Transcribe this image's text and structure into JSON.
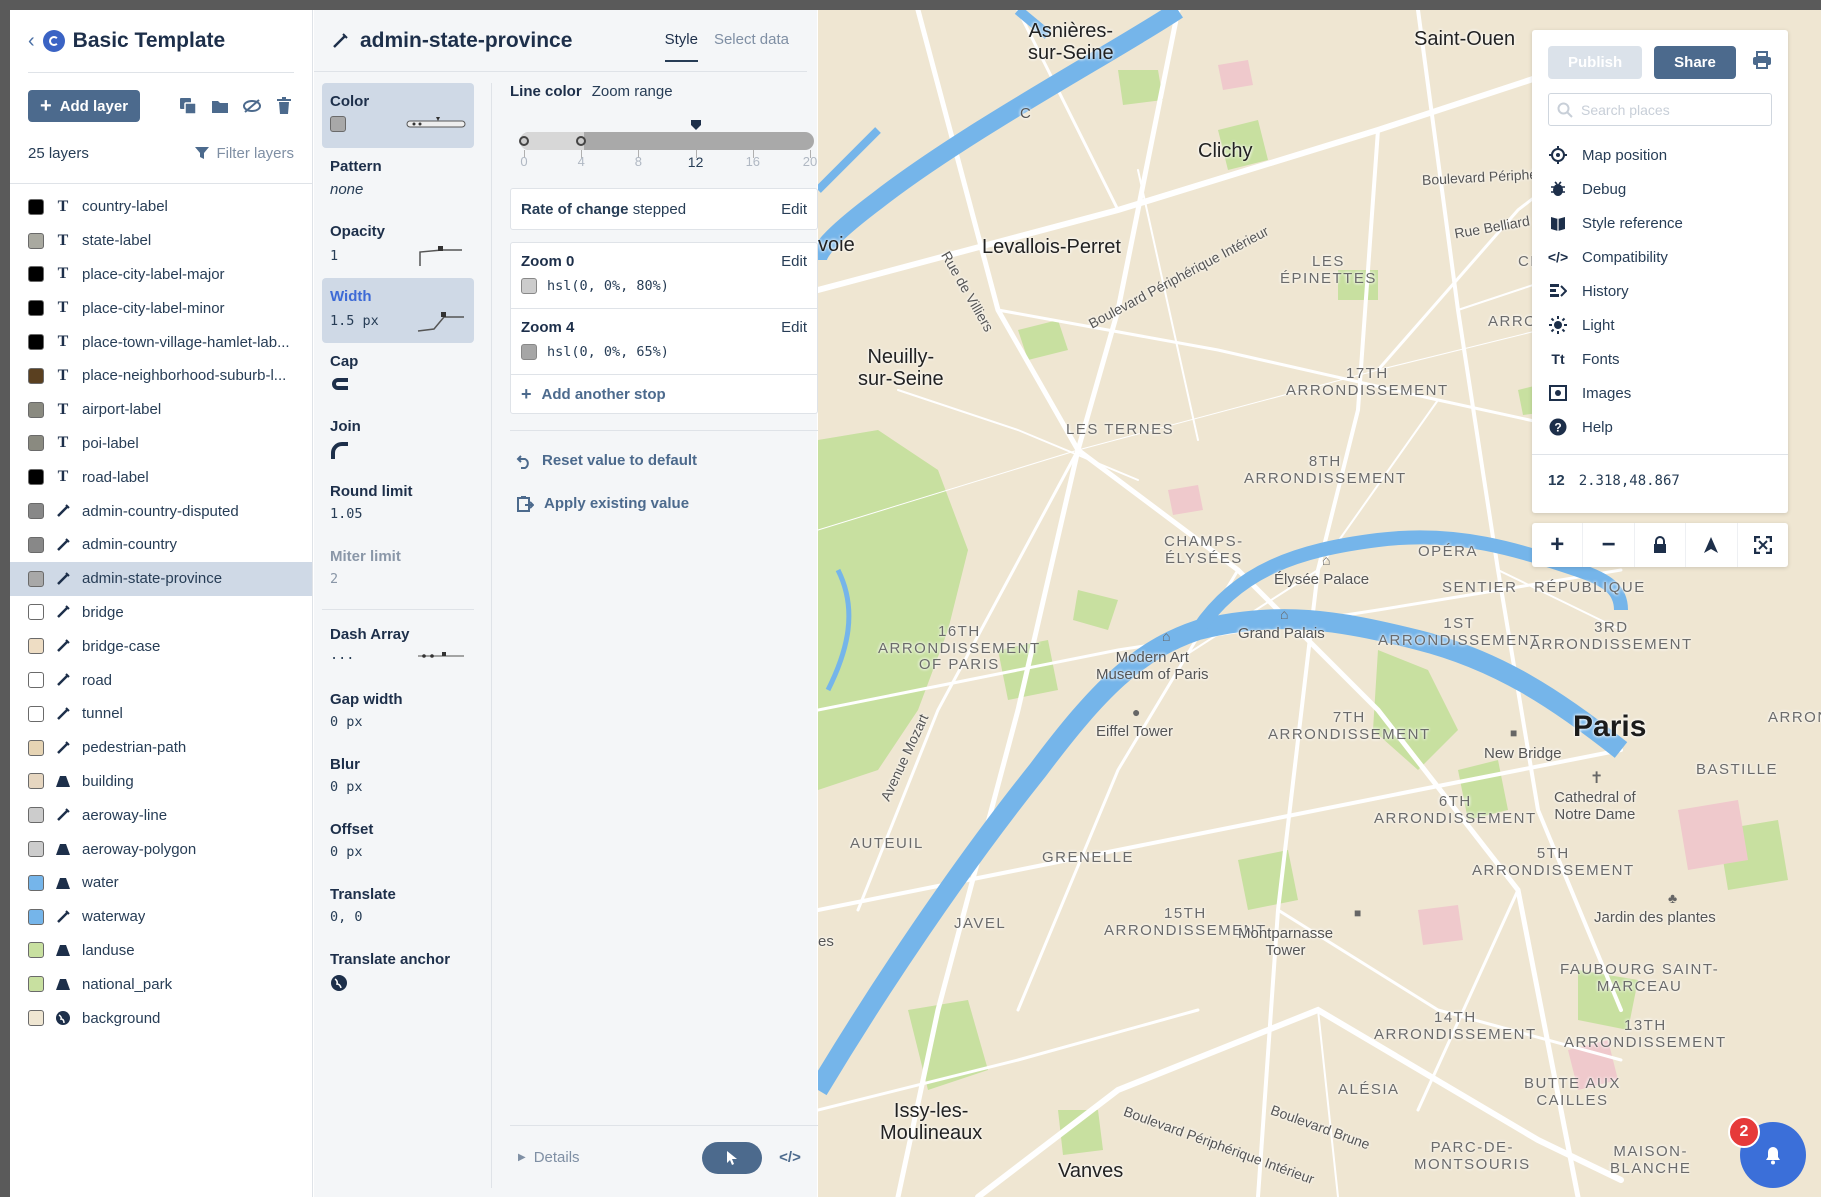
{
  "app": {
    "title": "Basic Template"
  },
  "toolbar": {
    "add_layer_label": "Add layer",
    "layer_count": "25 layers",
    "filter_label": "Filter layers"
  },
  "layers": [
    {
      "name": "country-label",
      "type": "T",
      "color": "#000000"
    },
    {
      "name": "state-label",
      "type": "T",
      "color": "#a9a9a0"
    },
    {
      "name": "place-city-label-major",
      "type": "T",
      "color": "#000000"
    },
    {
      "name": "place-city-label-minor",
      "type": "T",
      "color": "#000000"
    },
    {
      "name": "place-town-village-hamlet-lab...",
      "type": "T",
      "color": "#000000"
    },
    {
      "name": "place-neighborhood-suburb-l...",
      "type": "T",
      "color": "#5a4020"
    },
    {
      "name": "airport-label",
      "type": "T",
      "color": "#8a8a80"
    },
    {
      "name": "poi-label",
      "type": "T",
      "color": "#8a8a80"
    },
    {
      "name": "road-label",
      "type": "T",
      "color": "#000000"
    },
    {
      "name": "admin-country-disputed",
      "type": "line",
      "color": "#888888"
    },
    {
      "name": "admin-country",
      "type": "line",
      "color": "#888888"
    },
    {
      "name": "admin-state-province",
      "type": "line",
      "color": "#a8a8a8"
    },
    {
      "name": "bridge",
      "type": "line",
      "color": "#ffffff"
    },
    {
      "name": "bridge-case",
      "type": "line",
      "color": "#eeddc4"
    },
    {
      "name": "road",
      "type": "line",
      "color": "#ffffff"
    },
    {
      "name": "tunnel",
      "type": "line",
      "color": "#ffffff"
    },
    {
      "name": "pedestrian-path",
      "type": "line",
      "color": "#e6d4b4"
    },
    {
      "name": "building",
      "type": "fill",
      "color": "#e6d6c0"
    },
    {
      "name": "aeroway-line",
      "type": "line",
      "color": "#cccccc"
    },
    {
      "name": "aeroway-polygon",
      "type": "fill",
      "color": "#cccccc"
    },
    {
      "name": "water",
      "type": "fill",
      "color": "#75b5ea"
    },
    {
      "name": "waterway",
      "type": "line",
      "color": "#75b5ea"
    },
    {
      "name": "landuse",
      "type": "fill",
      "color": "#c8e0a0"
    },
    {
      "name": "national_park",
      "type": "fill",
      "color": "#c8e0a0"
    },
    {
      "name": "background",
      "type": "bg",
      "color": "#efe6d2"
    }
  ],
  "selected_layer": "admin-state-province",
  "props": {
    "title": "admin-state-province",
    "tab_style": "Style",
    "tab_select": "Select data",
    "color_label": "Color",
    "pattern_label": "Pattern",
    "pattern_value": "none",
    "opacity_label": "Opacity",
    "opacity_value": "1",
    "width_label": "Width",
    "width_value": "1.5 px",
    "cap_label": "Cap",
    "join_label": "Join",
    "round_limit_label": "Round limit",
    "round_limit_value": "1.05",
    "miter_limit_label": "Miter limit",
    "miter_limit_value": "2",
    "dash_array_label": "Dash Array",
    "dash_array_value": "...",
    "gap_width_label": "Gap width",
    "gap_width_value": "0 px",
    "blur_label": "Blur",
    "blur_value": "0 px",
    "offset_label": "Offset",
    "offset_value": "0 px",
    "translate_label": "Translate",
    "translate_value": "0, 0",
    "translate_anchor_label": "Translate anchor"
  },
  "editor": {
    "heading": "Line color",
    "subheading": "Zoom range",
    "ticks": [
      "0",
      "4",
      "8",
      "12",
      "16",
      "20"
    ],
    "current_zoom": 12,
    "stop_positions": [
      0,
      4
    ],
    "rate_label": "Rate of change",
    "rate_value": "stepped",
    "edit_label": "Edit",
    "stops": [
      {
        "title": "Zoom 0",
        "value": "hsl(0, 0%, 80%)",
        "color": "#cccccc"
      },
      {
        "title": "Zoom 4",
        "value": "hsl(0, 0%, 65%)",
        "color": "#a6a6a6"
      }
    ],
    "add_stop_label": "Add another stop",
    "reset_label": "Reset value to default",
    "apply_label": "Apply existing value",
    "details_label": "Details"
  },
  "map_menu": {
    "publish_label": "Publish",
    "share_label": "Share",
    "search_placeholder": "Search places",
    "items": [
      {
        "label": "Map position",
        "icon": "crosshair-icon"
      },
      {
        "label": "Debug",
        "icon": "bug-icon"
      },
      {
        "label": "Style reference",
        "icon": "book-icon"
      },
      {
        "label": "Compatibility",
        "icon": "code-icon"
      },
      {
        "label": "History",
        "icon": "history-icon"
      },
      {
        "label": "Light",
        "icon": "sun-icon"
      },
      {
        "label": "Fonts",
        "icon": "fonts-icon"
      },
      {
        "label": "Images",
        "icon": "image-icon"
      },
      {
        "label": "Help",
        "icon": "help-icon"
      }
    ],
    "zoom_level": "12",
    "coordinates": "2.318,48.867"
  },
  "notifications": {
    "count": "2"
  },
  "map_labels": {
    "asnieres": "Asnières-\nsur-Seine",
    "saint_ouen": "Saint-Ouen",
    "clichy": "Clichy",
    "levallois": "Levallois-Perret",
    "neuilly": "Neuilly-\nsur-Seine",
    "paris": "Paris",
    "issy": "Issy-les-\nMoulineaux",
    "vanves": "Vanves",
    "epinettes": "LES\nÉPINETTES",
    "arr17": "17TH\nARRONDISSEMENT",
    "ternes": "LES TERNES",
    "arr8": "8TH\nARRONDISSEMENT",
    "champs": "CHAMPS-\nÉLYSÉES",
    "opera": "OPÉRA",
    "sentier": "SENTIER",
    "republique": "RÉPUBLIQUE",
    "arr16": "16TH\nARRONDISSEMENT\nOF PARIS",
    "arr1": "1ST\nARRONDISSEMENT",
    "arr3": "3RD\nARRONDISSEMENT",
    "arr7": "7TH\nARRONDISSEMENT",
    "bastille": "BASTILLE",
    "auteuil": "AUTEUIL",
    "arr6": "6TH\nARRONDISSEMENT",
    "grenelle": "GRENELLE",
    "arr5": "5TH\nARRONDISSEMENT",
    "javel": "JAVEL",
    "arr15": "15TH\nARRONDISSEMENT",
    "faubourg": "FAUBOURG SAINT-\nMARCEAU",
    "arr14": "14TH\nARRONDISSEMENT",
    "arr13": "13TH\nARRONDISSEMENT",
    "alesia": "ALÉSIA",
    "butte": "BUTTE AUX\nCAILLES",
    "parc": "PARC-DE-\nMONTSOURIS",
    "maison": "MAISON-\nBLANCHE",
    "elysee": "Élysée Palace",
    "grand_palais": "Grand Palais",
    "modern_art": "Modern Art\nMuseum of Paris",
    "eiffel": "Eiffel Tower",
    "new_bridge": "New Bridge",
    "notre_dame": "Cathedral of\nNotre Dame",
    "montparnasse": "Montparnasse\nTower",
    "jardin": "Jardin des plantes",
    "blvd_peri": "Boulevard Périphé",
    "rue_belliard": "Rue Belliard",
    "clign": "CLIGN",
    "arron_r": "ARRON",
    "voie": "voie",
    "rue_villiers": "Rue de Villiers",
    "blvd_peri_int": "Boulevard Périphérique Intérieur",
    "ave_mozart": "Avenue Mozart",
    "blvd_brune": "Boulevard Brune",
    "blvd_peri_int2": "Boulevard Périphérique Intérieur",
    "es": "es",
    "arron_r2": "ARRON",
    "c_letter": "C"
  },
  "colors": {
    "accent": "#4c6a8d",
    "selected": "#cfd9e6",
    "water": "#75b5ea",
    "land": "#efe6d2",
    "park": "#c8e0a0",
    "notif": "#3b6fd9",
    "badge": "#e63a3a"
  }
}
